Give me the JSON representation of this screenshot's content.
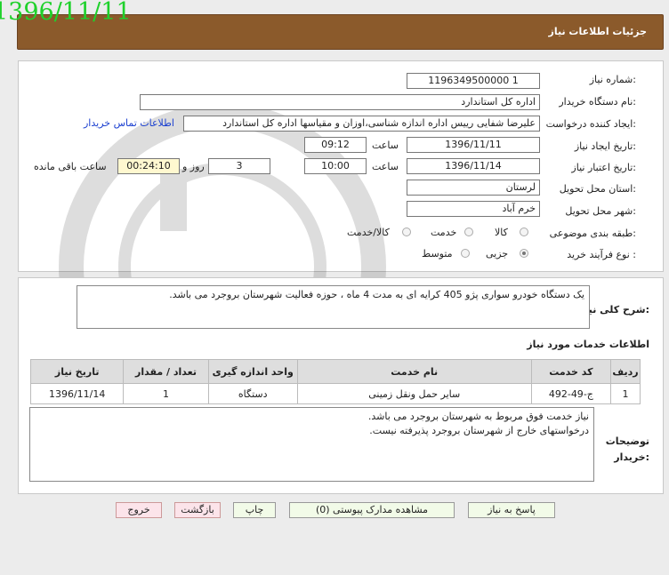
{
  "header": {
    "title": "جزئیات اطلاعات نیاز",
    "date_overlay": "1396/11/11"
  },
  "form": {
    "need_number_label": "شماره نیاز:",
    "need_number": "1196349500000 1",
    "buyer_org_label": "نام دستگاه خریدار:",
    "buyer_org": "اداره کل استاندارد",
    "requester_label": "ایجاد کننده درخواست:",
    "requester": "علیرضا  شفایی رییس اداره اندازه شناسی،اوزان و مقیاسها اداره کل استاندارد",
    "contact_link": "اطلاعات تماس خریدار",
    "created_date_label": "تاریخ ایجاد نیاز:",
    "created_date": "1396/11/11",
    "created_time_label": "ساعت",
    "created_time": "09:12",
    "validity_date_label": "تاریخ اعتبار نیاز:",
    "validity_date": "1396/11/14",
    "validity_time_label": "ساعت",
    "validity_time": "10:00",
    "days": "3",
    "days_label": "روز و",
    "remaining_time": "00:24:10",
    "remaining_label": "ساعت باقی مانده",
    "province_label": "استان محل تحویل:",
    "province": "لرستان",
    "city_label": "شهر محل تحویل:",
    "city": "خرم آباد",
    "category_label": "طبقه بندی موضوعی:",
    "category_options": [
      "کالا",
      "خدمت",
      "کالا/خدمت"
    ],
    "category_selected": "کالا",
    "process_label": "نوع فرآیند خرید :",
    "process_options": [
      "جزیی",
      "متوسط"
    ],
    "process_selected": "جزیی"
  },
  "description": {
    "label": "شرح کلی نیاز:",
    "text": "یک دستگاه خودرو سواری پژو 405 کرایه ای به مدت 4 ماه ، حوزه فعالیت شهرستان بروجرد می باشد."
  },
  "services": {
    "title": "اطلاعات خدمات مورد نیاز",
    "columns": [
      "ردیف",
      "کد خدمت",
      "نام خدمت",
      "واحد اندازه گیری",
      "تعداد / مقدار",
      "تاریخ نیاز"
    ],
    "rows": [
      [
        "1",
        "ج-49-492",
        "سایر حمل ونقل زمینی",
        "دستگاه",
        "1",
        "1396/11/14"
      ]
    ]
  },
  "buyer_notes": {
    "label": "توضیحات خریدار:",
    "lines": [
      "نیاز خدمت فوق مربوط به شهرستان بروجرد می باشد.",
      "درخواستهای خارج از شهرستان بروجرد پذیرفته نیست."
    ]
  },
  "buttons": {
    "reply": "پاسخ به نیاز",
    "attachments": "مشاهده مدارک پیوستی (0)",
    "print": "چاپ",
    "back": "بازگشت",
    "exit": "خروج"
  },
  "colors": {
    "header_bg": "#8b5a2b",
    "date_overlay": "#1fd12b",
    "link": "#1a3fd0"
  }
}
